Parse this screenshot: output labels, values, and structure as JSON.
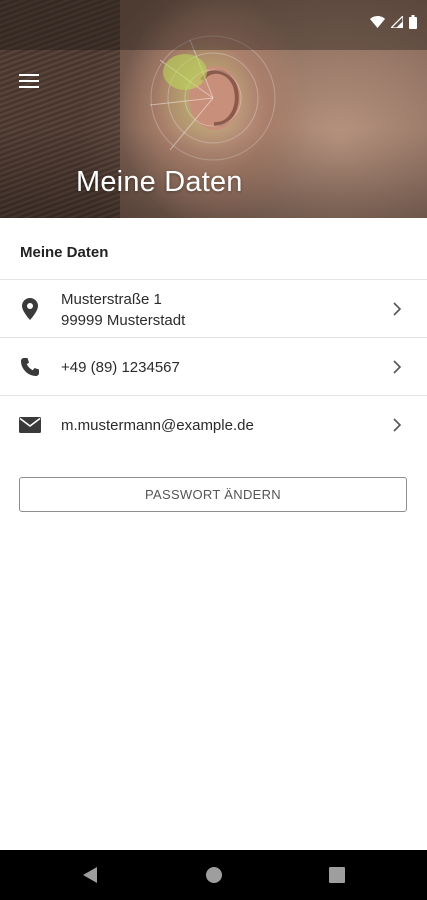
{
  "header": {
    "title": "Meine Daten",
    "menu_icon": "hamburger-menu-icon"
  },
  "status_bar": {
    "icons": [
      "wifi-icon",
      "signal-icon",
      "battery-icon"
    ]
  },
  "section": {
    "title": "Meine Daten"
  },
  "contact": {
    "address": {
      "icon": "location-pin-icon",
      "street": "Musterstraße 1",
      "city": "99999 Musterstadt"
    },
    "phone": {
      "icon": "phone-icon",
      "value": "+49 (89) 1234567"
    },
    "email": {
      "icon": "envelope-icon",
      "value": "m.mustermann@example.de"
    }
  },
  "actions": {
    "change_password": "PASSWORT ÄNDERN"
  },
  "navigation": {
    "icons": [
      "back-triangle-icon",
      "home-circle-icon",
      "recents-square-icon"
    ]
  },
  "colors": {
    "text_primary": "#222222",
    "divider": "#e3e3e3",
    "icon": "#3a3a3a",
    "button_border": "#8e8e8e",
    "nav_bar": "#000000"
  }
}
